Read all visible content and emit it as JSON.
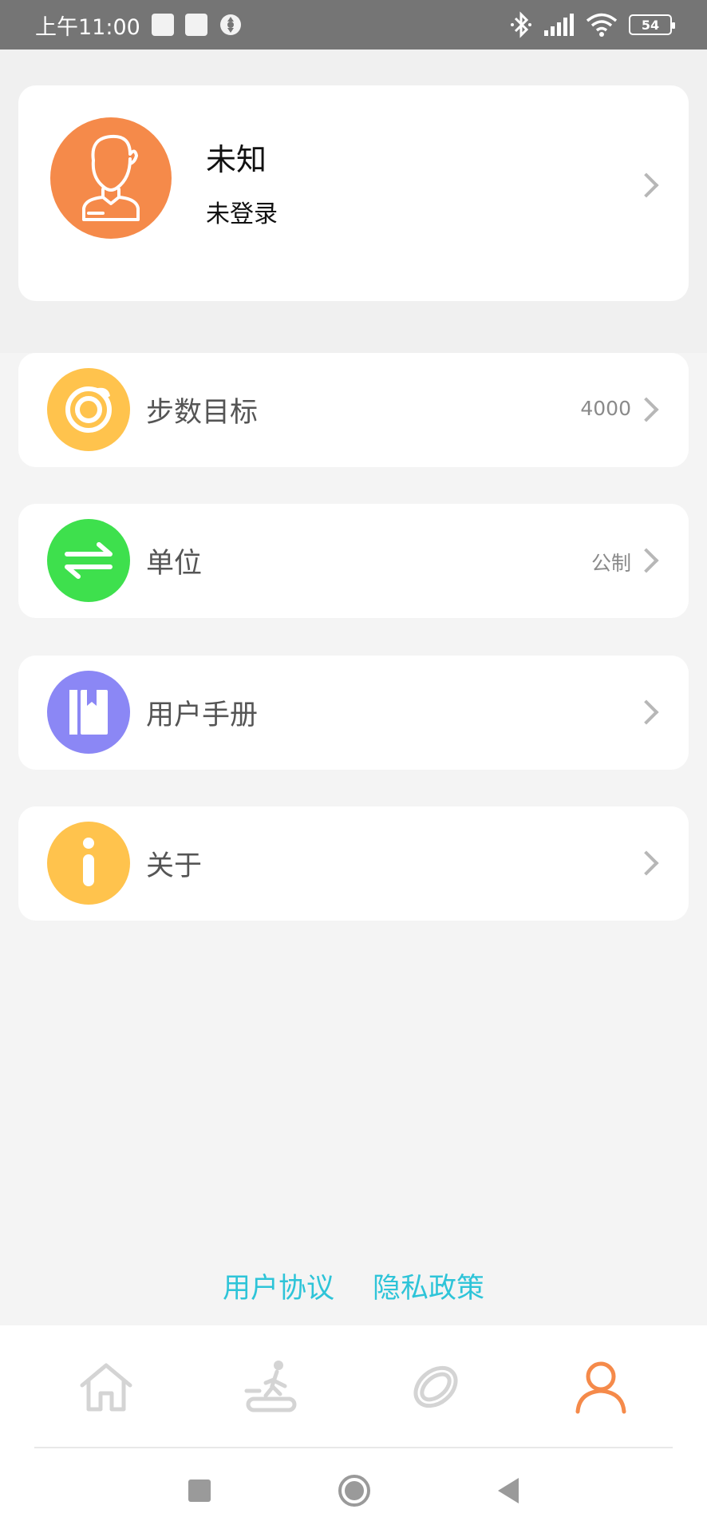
{
  "status_bar": {
    "time": "上午11:00",
    "battery": "54"
  },
  "profile": {
    "name": "未知",
    "status": "未登录"
  },
  "menu": [
    {
      "label": "步数目标",
      "value": "4000",
      "icon": "target-icon",
      "color": "#ffc34d"
    },
    {
      "label": "单位",
      "value": "公制",
      "icon": "swap-icon",
      "color": "#3ee04d"
    },
    {
      "label": "用户手册",
      "value": "",
      "icon": "book-icon",
      "color": "#8b87f5"
    },
    {
      "label": "关于",
      "value": "",
      "icon": "info-icon",
      "color": "#ffc34d"
    }
  ],
  "footer_links": {
    "agreement": "用户协议",
    "privacy": "隐私政策"
  },
  "tabs": [
    {
      "icon": "home-icon",
      "active": false
    },
    {
      "icon": "treadmill-icon",
      "active": false
    },
    {
      "icon": "ring-icon",
      "active": false
    },
    {
      "icon": "user-icon",
      "active": true
    }
  ],
  "colors": {
    "accent": "#f58a4a",
    "link": "#2ec4d8",
    "inactive_icon": "#d4d4d4"
  }
}
